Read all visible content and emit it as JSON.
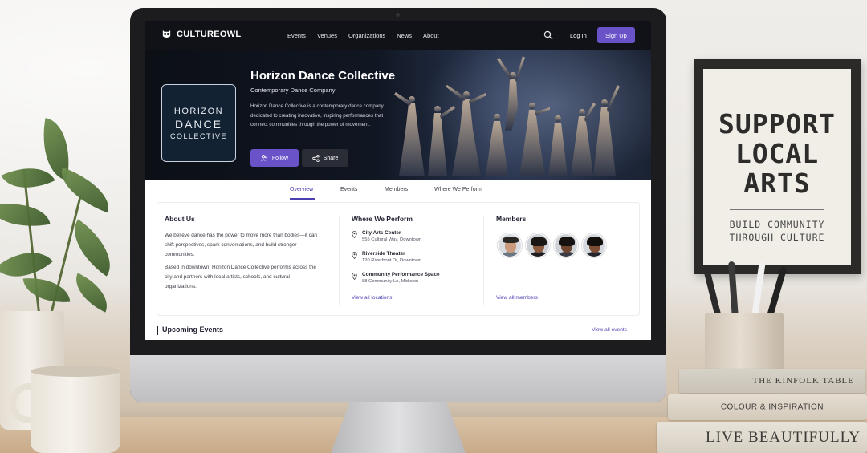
{
  "app": {
    "brand": "CULTUREOWL",
    "nav": [
      "Events",
      "Venues",
      "Organizations",
      "News",
      "About"
    ],
    "login_label": "Log In",
    "signup_label": "Sign Up"
  },
  "hero": {
    "logo_lines": [
      "HORIZON",
      "DANCE",
      "COLLECTIVE"
    ],
    "name": "Horizon Dance Collective",
    "type": "Contemporary Dance Company",
    "description": "Horizon Dance Collective is a contemporary dance company dedicated to creating innovative, inspiring performances that connect communities through the power of movement.",
    "follow_label": "Follow",
    "share_label": "Share"
  },
  "tabs": [
    {
      "label": "Overview",
      "active": true
    },
    {
      "label": "Events",
      "active": false
    },
    {
      "label": "Members",
      "active": false
    },
    {
      "label": "Where We Perform",
      "active": false
    }
  ],
  "about": {
    "title": "About Us",
    "paragraphs": [
      "We believe dance has the power to move more than bodies—it can shift perspectives, spark conversations, and build stronger communities.",
      "Based in downtown, Horizon Dance Collective performs across the city and partners with local artists, schools, and cultural organizations."
    ]
  },
  "perform": {
    "title": "Where We Perform",
    "locations": [
      {
        "name": "City Arts Center",
        "address": "555 Cultural Way, Downtown"
      },
      {
        "name": "Riverside Theater",
        "address": "120 Riverfront Dr, Downtown"
      },
      {
        "name": "Community Performance Space",
        "address": "88 Community Ln, Midtown"
      }
    ],
    "view_all": "View all locations"
  },
  "members": {
    "title": "Members",
    "view_all": "View all members"
  },
  "upcoming": {
    "title": "Upcoming Events",
    "view_all": "View all events"
  },
  "scene": {
    "poster_lines": [
      "SUPPORT",
      "LOCAL",
      "ARTS"
    ],
    "poster_sub": [
      "BUILD COMMUNITY",
      "THROUGH CULTURE"
    ],
    "books": [
      "THE KINFOLK TABLE",
      "COLOUR & INSPIRATION",
      "LIVE BEAUTIFULLY"
    ]
  },
  "colors": {
    "accent": "#6a52c8",
    "nav_bg": "#111218",
    "link": "#4a3fb0"
  }
}
